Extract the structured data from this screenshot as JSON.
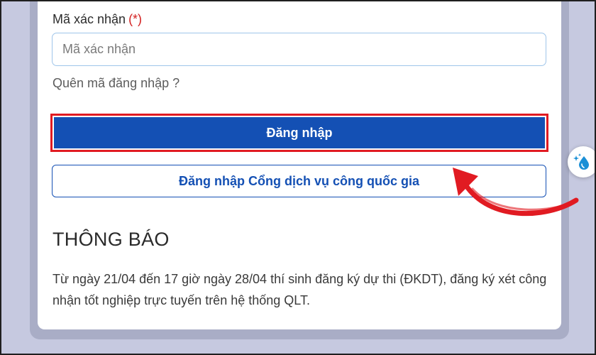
{
  "form": {
    "captcha_label": "Mã xác nhận",
    "required_mark": "(*)",
    "captcha_placeholder": "Mã xác nhận",
    "captcha_value": "",
    "forgot_link": "Quên mã đăng nhập ?",
    "login_button": "Đăng nhập",
    "national_portal_button": "Đăng nhập Cổng dịch vụ công quốc gia"
  },
  "notice": {
    "title": "THÔNG BÁO",
    "body": "Từ ngày 21/04 đến 17 giờ ngày 28/04 thí sinh đăng ký dự thi (ĐKDT), đăng ký xét công nhận tốt nghiệp trực tuyến trên hệ thống QLT."
  },
  "annotation": {
    "highlight_color": "#e11b22",
    "arrow_color": "#e11b22"
  },
  "colors": {
    "primary": "#1450b4",
    "required": "#d32020",
    "background": "#c6c9e0"
  },
  "icons": {
    "side_widget": "water-drop-sparkle-icon"
  }
}
